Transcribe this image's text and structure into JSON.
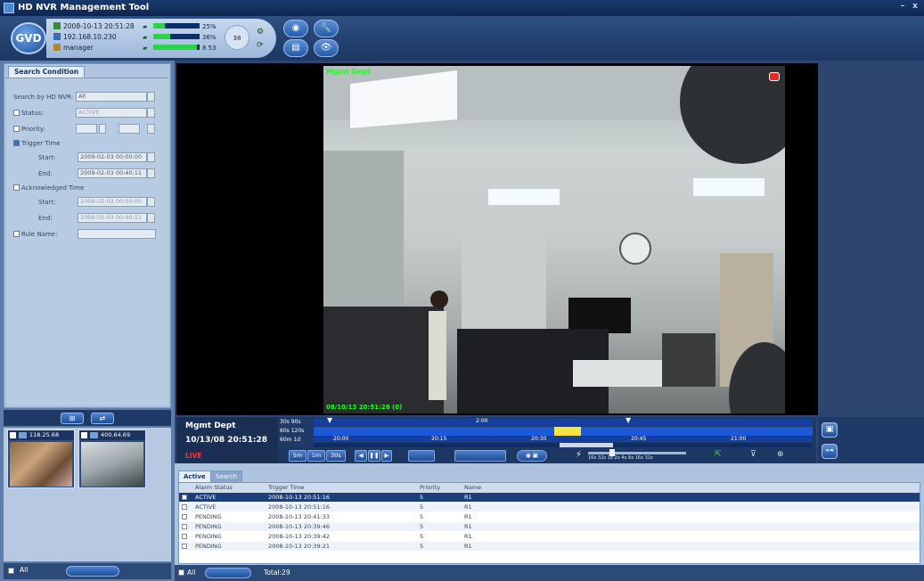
{
  "app": {
    "title": "HD NVR Management Tool",
    "logo_text": "GVD",
    "minimize": "–",
    "close": "x"
  },
  "status": {
    "datetime": "2008-10-13  20:51:28",
    "ip": "192.168.10.230",
    "user": "manager",
    "clock_value": "38",
    "meters": [
      {
        "icon": "network-icon",
        "percent": 25,
        "label": "25%"
      },
      {
        "icon": "cpu-icon",
        "percent": 36,
        "label": "36%"
      },
      {
        "icon": "storage-icon",
        "percent": 95,
        "label": "8 53"
      }
    ]
  },
  "toolbar": {
    "buttons": [
      {
        "name": "live-view-button",
        "icon": "camera-lens-icon",
        "glyph": "◉"
      },
      {
        "name": "setup-button",
        "icon": "wrench-icon",
        "glyph": "🔧"
      },
      {
        "name": "log-button",
        "icon": "document-icon",
        "glyph": "▤"
      },
      {
        "name": "playback-button",
        "icon": "eye-icon",
        "glyph": "👁"
      }
    ]
  },
  "search": {
    "tab_label": "Search Condition",
    "by_nvr_label": "Search by HD NVR:",
    "by_nvr_value": "All",
    "status_label": "Status:",
    "status_value": "ACTIVE",
    "priority_label": "Priority:",
    "trigger_time_label": "Trigger Time",
    "start_label": "Start:",
    "end_label": "End:",
    "trigger_start": "2009-02-03 00:00:00",
    "trigger_end": "2009-02-03 00:40:11",
    "ack_time_label": "Acknowledged Time",
    "ack_start": "2009-02-03 00:00:00",
    "ack_end": "2009-02-03 00:40:11",
    "rule_name_label": "Rule Name:"
  },
  "thumbs": [
    {
      "label": "118.25.68"
    },
    {
      "label": "400.64.69"
    }
  ],
  "left_bottom": {
    "all_label": "All"
  },
  "video": {
    "camera_label": "Mgmt Dept",
    "timestamp": "08/10/13 20:51:28 (0)",
    "rec_icon": "record-icon"
  },
  "info": {
    "name": "Mgmt Dept",
    "time": "10/13/08 20:51:28",
    "mode": "LIVE"
  },
  "timeline": {
    "scale_labels_top": [
      "30s",
      "90s"
    ],
    "scale_labels_mid": [
      "60s",
      "120s"
    ],
    "scale_labels_bot": [
      "60m",
      "1d"
    ],
    "ticks_top": [
      "2:00"
    ],
    "ticks_mid": [
      "20:00",
      "20:15",
      "20:30",
      "20:45",
      "21:00"
    ],
    "controls": {
      "step_5m": "5m",
      "step_1m": "1m",
      "step_30s": "30s",
      "speed_labels": "16x 32x 1x 2x 4x 8x 16x 32x"
    }
  },
  "events": {
    "tabs": [
      "Active",
      "Search"
    ],
    "columns": [
      "Alarm Status",
      "Trigger Time",
      "Priority",
      "Name"
    ],
    "rows": [
      {
        "status": "ACTIVE",
        "time": "2008-10-13 20:51:16",
        "priority": "5",
        "name": "R1"
      },
      {
        "status": "ACTIVE",
        "time": "2008-10-13 20:51:16",
        "priority": "5",
        "name": "R1"
      },
      {
        "status": "PENDING",
        "time": "2008-10-13 20:41:33",
        "priority": "5",
        "name": "R1"
      },
      {
        "status": "PENDING",
        "time": "2008-10-13 20:39:46",
        "priority": "5",
        "name": "R1"
      },
      {
        "status": "PENDING",
        "time": "2008-10-13 20:39:42",
        "priority": "5",
        "name": "R1"
      },
      {
        "status": "PENDING",
        "time": "2008-10-13 20:39:21",
        "priority": "5",
        "name": "R1"
      }
    ],
    "all_label": "All",
    "total": "Total:29"
  }
}
